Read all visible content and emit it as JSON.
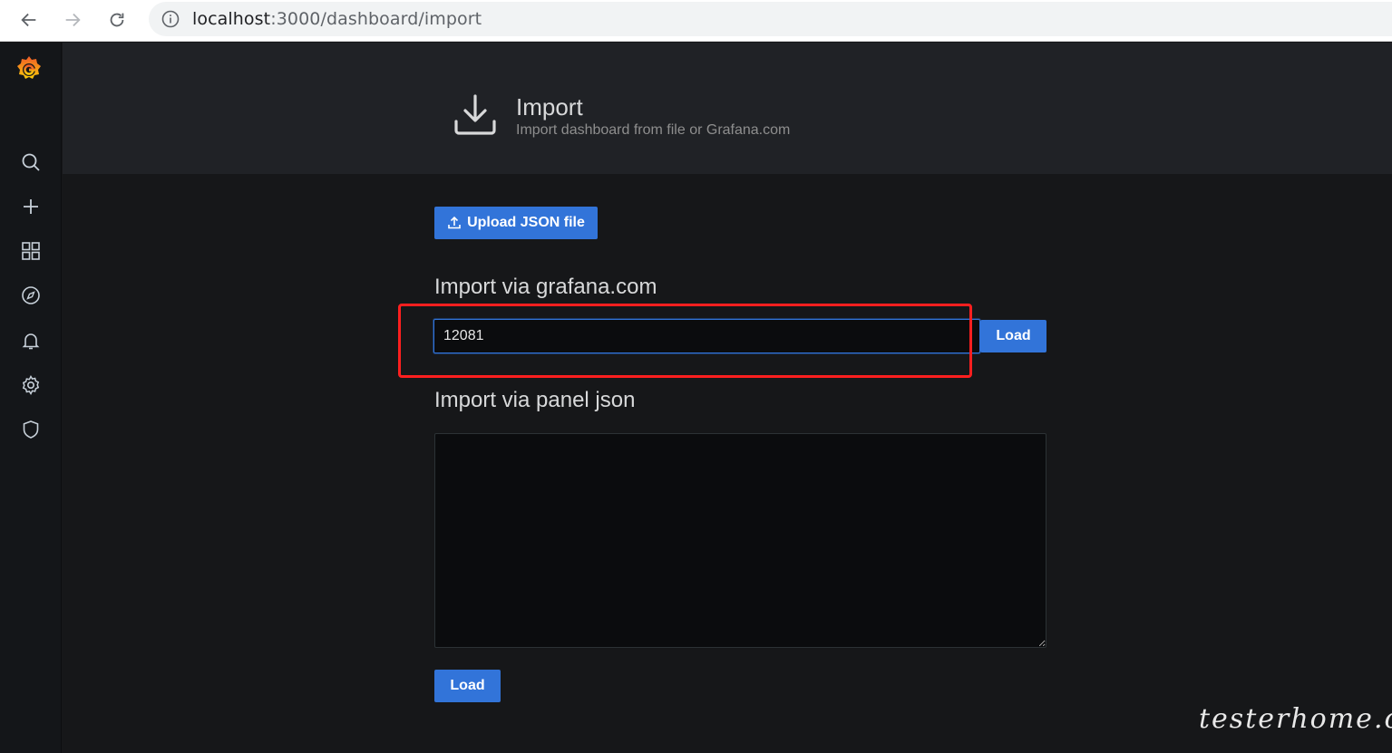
{
  "browser": {
    "url_host": "localhost",
    "url_path": ":3000/dashboard/import"
  },
  "sidemenu": {
    "items": [
      {
        "name": "search",
        "icon": "search-icon"
      },
      {
        "name": "create",
        "icon": "plus-icon"
      },
      {
        "name": "dashboards",
        "icon": "grid-icon"
      },
      {
        "name": "explore",
        "icon": "compass-icon"
      },
      {
        "name": "alerting",
        "icon": "bell-icon"
      },
      {
        "name": "configuration",
        "icon": "gear-icon"
      },
      {
        "name": "server-admin",
        "icon": "shield-icon"
      }
    ]
  },
  "header": {
    "title": "Import",
    "subtitle": "Import dashboard from file or Grafana.com"
  },
  "upload": {
    "label": "Upload JSON file"
  },
  "grafana_import": {
    "label": "Import via grafana.com",
    "value": "12081",
    "load_label": "Load"
  },
  "panel_json": {
    "label": "Import via panel json",
    "value": "",
    "load_label": "Load"
  },
  "watermark": "testerhome.com",
  "colors": {
    "primary": "#3274d9",
    "highlight": "#ff1f1f",
    "background": "#161719",
    "header": "#202226"
  }
}
